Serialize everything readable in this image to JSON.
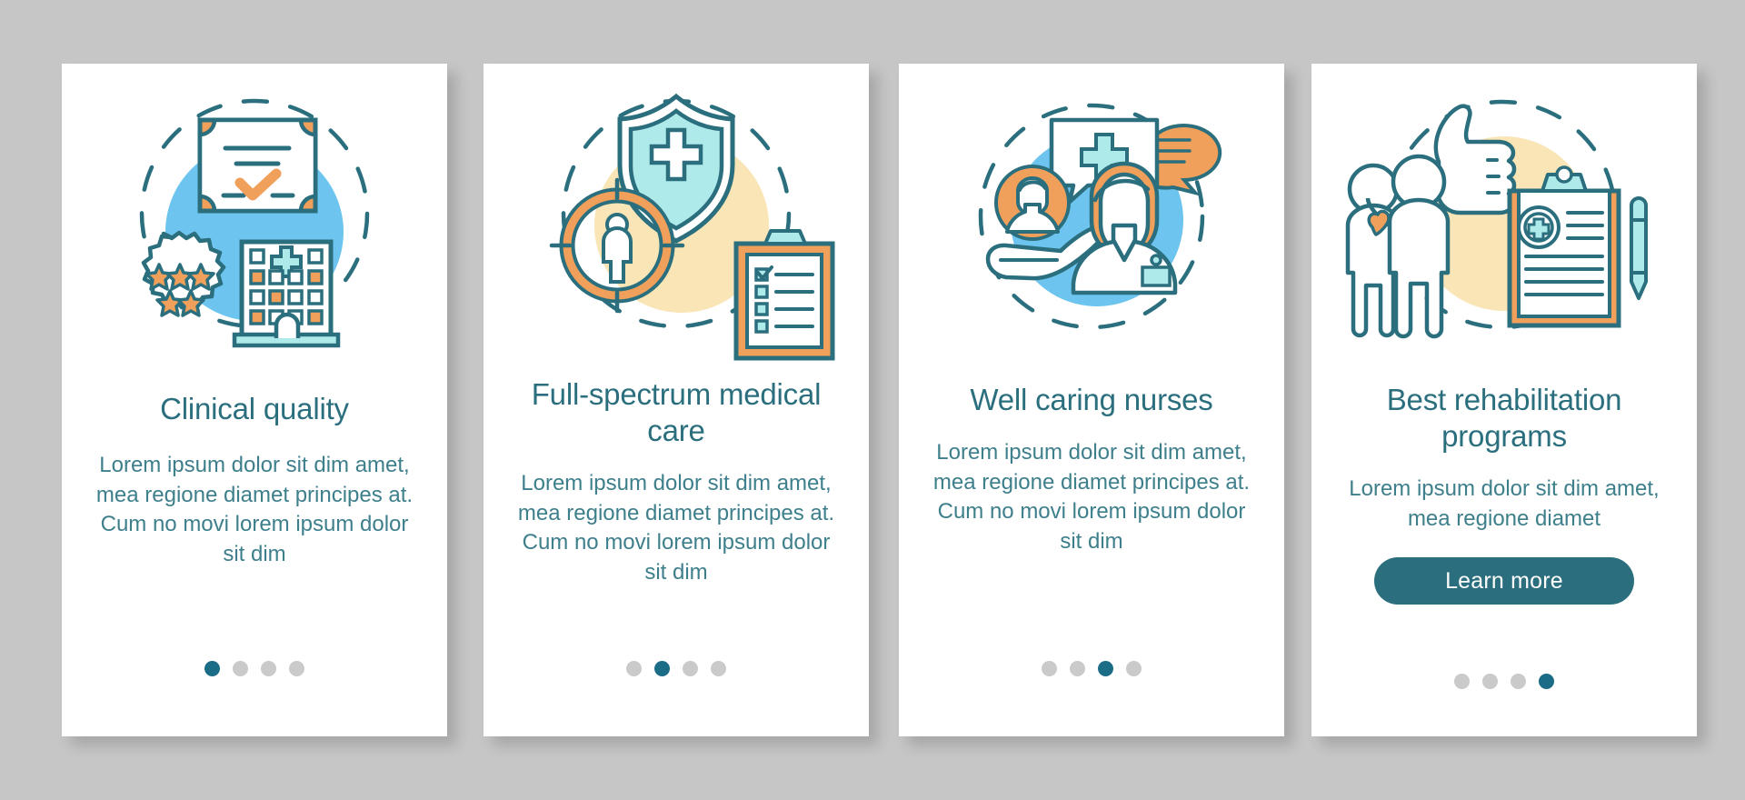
{
  "meta": {
    "kind": "onboarding-screens",
    "background_color": "#c6c6c6",
    "card_background": "#ffffff",
    "accent_teal": "#2b6f7e",
    "accent_orange": "#f0a05a",
    "accent_blue": "#6dc5ef",
    "accent_cyan": "#aeeaea",
    "accent_sand": "#fae5b6",
    "dot_active": "#1b6c86",
    "dot_inactive": "#cacaca"
  },
  "cards": [
    {
      "id": "clinical-quality",
      "title": "Clinical quality",
      "body": "Lorem ipsum dolor sit dim amet, mea regione diamet principes at. Cum no movi lorem ipsum dolor sit dim",
      "icon_name": "certificate-stars-hospital-icon",
      "dots": {
        "count": 4,
        "active": 1
      },
      "button": null
    },
    {
      "id": "full-spectrum-medical-care",
      "title": "Full-spectrum medical care",
      "body": "Lorem ipsum dolor sit dim amet, mea regione diamet principes at. Cum no movi lorem ipsum dolor sit dim",
      "icon_name": "shield-target-checklist-icon",
      "dots": {
        "count": 4,
        "active": 2
      },
      "button": null
    },
    {
      "id": "well-caring-nurses",
      "title": "Well caring nurses",
      "body": "Lorem ipsum dolor sit dim amet, mea regione diamet principes at. Cum no movi lorem ipsum dolor sit dim",
      "icon_name": "nurse-patient-chat-icon",
      "dots": {
        "count": 4,
        "active": 3
      },
      "button": null
    },
    {
      "id": "best-rehabilitation-programs",
      "title": "Best rehabilitation programs",
      "body": "Lorem ipsum dolor sit dim amet, mea regione diamet",
      "icon_name": "thumbs-up-patients-clipboard-icon",
      "dots": {
        "count": 4,
        "active": 4
      },
      "button": {
        "label": "Learn more"
      }
    }
  ]
}
